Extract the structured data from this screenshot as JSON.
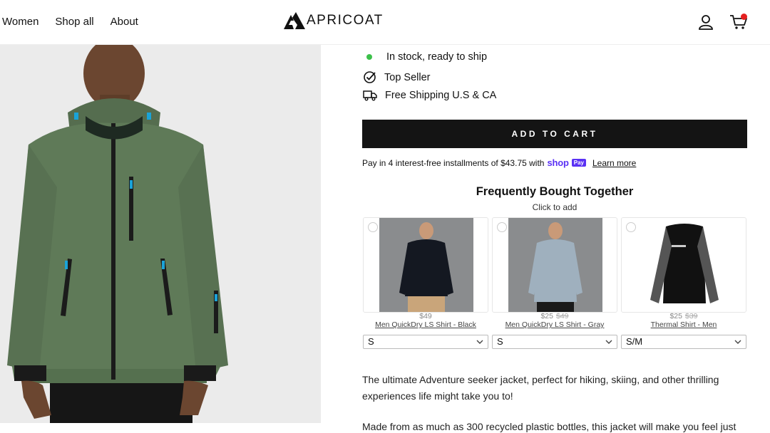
{
  "nav": {
    "items": [
      "Women",
      "Shop all",
      "About"
    ]
  },
  "brand": {
    "name": "APRICOAT"
  },
  "header": {
    "account_icon": "user-icon",
    "cart_icon": "cart-icon"
  },
  "product": {
    "features": [
      {
        "icon": "in-stock-dot-icon",
        "text": "In stock, ready to ship"
      },
      {
        "icon": "check-circle-icon",
        "text": "Top Seller"
      },
      {
        "icon": "truck-icon",
        "text": "Free Shipping U.S & CA"
      }
    ],
    "add_to_cart": "ADD TO CART",
    "installments": {
      "text": "Pay in 4 interest-free installments of $43.75 with",
      "shop": "shop",
      "pay": "Pay",
      "learn_more": "Learn more"
    },
    "description": [
      "The ultimate Adventure seeker jacket, perfect for hiking, skiing, and other thrilling experiences life might take you to!",
      "Made from as much as 300 recycled plastic bottles, this jacket will make you feel just"
    ]
  },
  "fbt": {
    "title": "Frequently Bought Together",
    "subtitle": "Click to add",
    "items": [
      {
        "price": "$49",
        "old_price": "",
        "name": "Men QuickDry LS Shirt - Black",
        "size": "S"
      },
      {
        "price": "$25",
        "old_price": "$49",
        "name": "Men QuickDry LS Shirt - Gray",
        "size": "S"
      },
      {
        "price": "$25",
        "old_price": "$39",
        "name": "Thermal Shirt - Men",
        "size": "S/M"
      }
    ]
  },
  "colors": {
    "accent": "#141414",
    "in_stock": "#3cc04a",
    "shop_pay": "#5a31f4",
    "cart_badge": "#e52020"
  }
}
